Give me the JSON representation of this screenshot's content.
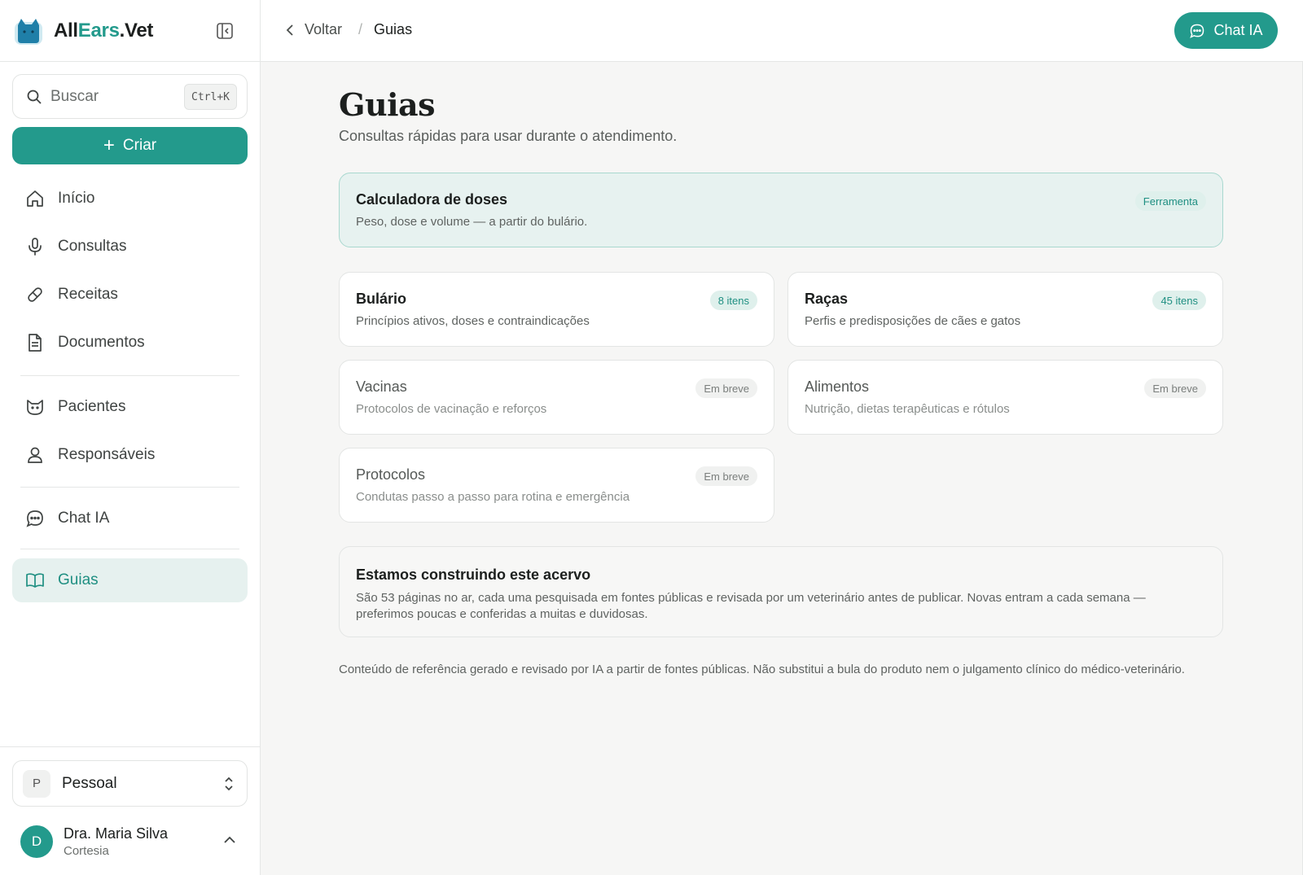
{
  "brand": {
    "name_part1": "All",
    "name_part2": "Ears",
    "name_part3": ".Vet"
  },
  "search": {
    "placeholder": "Buscar",
    "shortcut": "Ctrl+K"
  },
  "create_button": {
    "label": "Criar"
  },
  "nav": {
    "items": [
      {
        "id": "inicio",
        "label": "Início",
        "icon": "home-icon"
      },
      {
        "id": "consultas",
        "label": "Consultas",
        "icon": "microphone-icon"
      },
      {
        "id": "receitas",
        "label": "Receitas",
        "icon": "pill-icon"
      },
      {
        "id": "documentos",
        "label": "Documentos",
        "icon": "document-icon"
      },
      {
        "id": "pacientes",
        "label": "Pacientes",
        "icon": "cat-icon"
      },
      {
        "id": "responsaveis",
        "label": "Responsáveis",
        "icon": "user-icon"
      },
      {
        "id": "chat",
        "label": "Chat IA",
        "icon": "chat-icon"
      },
      {
        "id": "guias",
        "label": "Guias",
        "icon": "book-icon",
        "active": true
      }
    ]
  },
  "workspace": {
    "initial": "P",
    "name": "Pessoal"
  },
  "user": {
    "initial": "D",
    "name": "Dra. Maria Silva",
    "plan": "Cortesia"
  },
  "topbar": {
    "back_label": "Voltar",
    "separator": "/",
    "current": "Guias",
    "chat_button": "Chat IA"
  },
  "page": {
    "title": "Guias",
    "subtitle": "Consultas rápidas para usar durante o atendimento."
  },
  "cards": {
    "calculadora": {
      "title": "Calculadora de doses",
      "desc": "Peso, dose e volume — a partir do bulário.",
      "badge": "Ferramenta"
    },
    "bulario": {
      "title": "Bulário",
      "desc": "Princípios ativos, doses e contraindicações",
      "badge": "8 itens"
    },
    "racas": {
      "title": "Raças",
      "desc": "Perfis e predisposições de cães e gatos",
      "badge": "45 itens"
    },
    "vacinas": {
      "title": "Vacinas",
      "desc": "Protocolos de vacinação e reforços",
      "badge": "Em breve"
    },
    "alimentos": {
      "title": "Alimentos",
      "desc": "Nutrição, dietas terapêuticas e rótulos",
      "badge": "Em breve"
    },
    "protocolos": {
      "title": "Protocolos",
      "desc": "Condutas passo a passo para rotina e emergência",
      "badge": "Em breve"
    }
  },
  "info": {
    "title": "Estamos construindo este acervo",
    "text": "São 53 páginas no ar, cada uma pesquisada em fontes públicas e revisada por um veterinário antes de publicar. Novas entram a cada semana — preferimos poucas e conferidas a muitas e duvidosas."
  },
  "disclaimer": "Conteúdo de referência gerado e revisado por IA a partir de fontes públicas. Não substitui a bula do produto nem o julgamento clínico do médico-veterinário.",
  "colors": {
    "accent": "#239a8c",
    "accent_light": "#e6f1ef",
    "background": "#f6f6f5"
  }
}
